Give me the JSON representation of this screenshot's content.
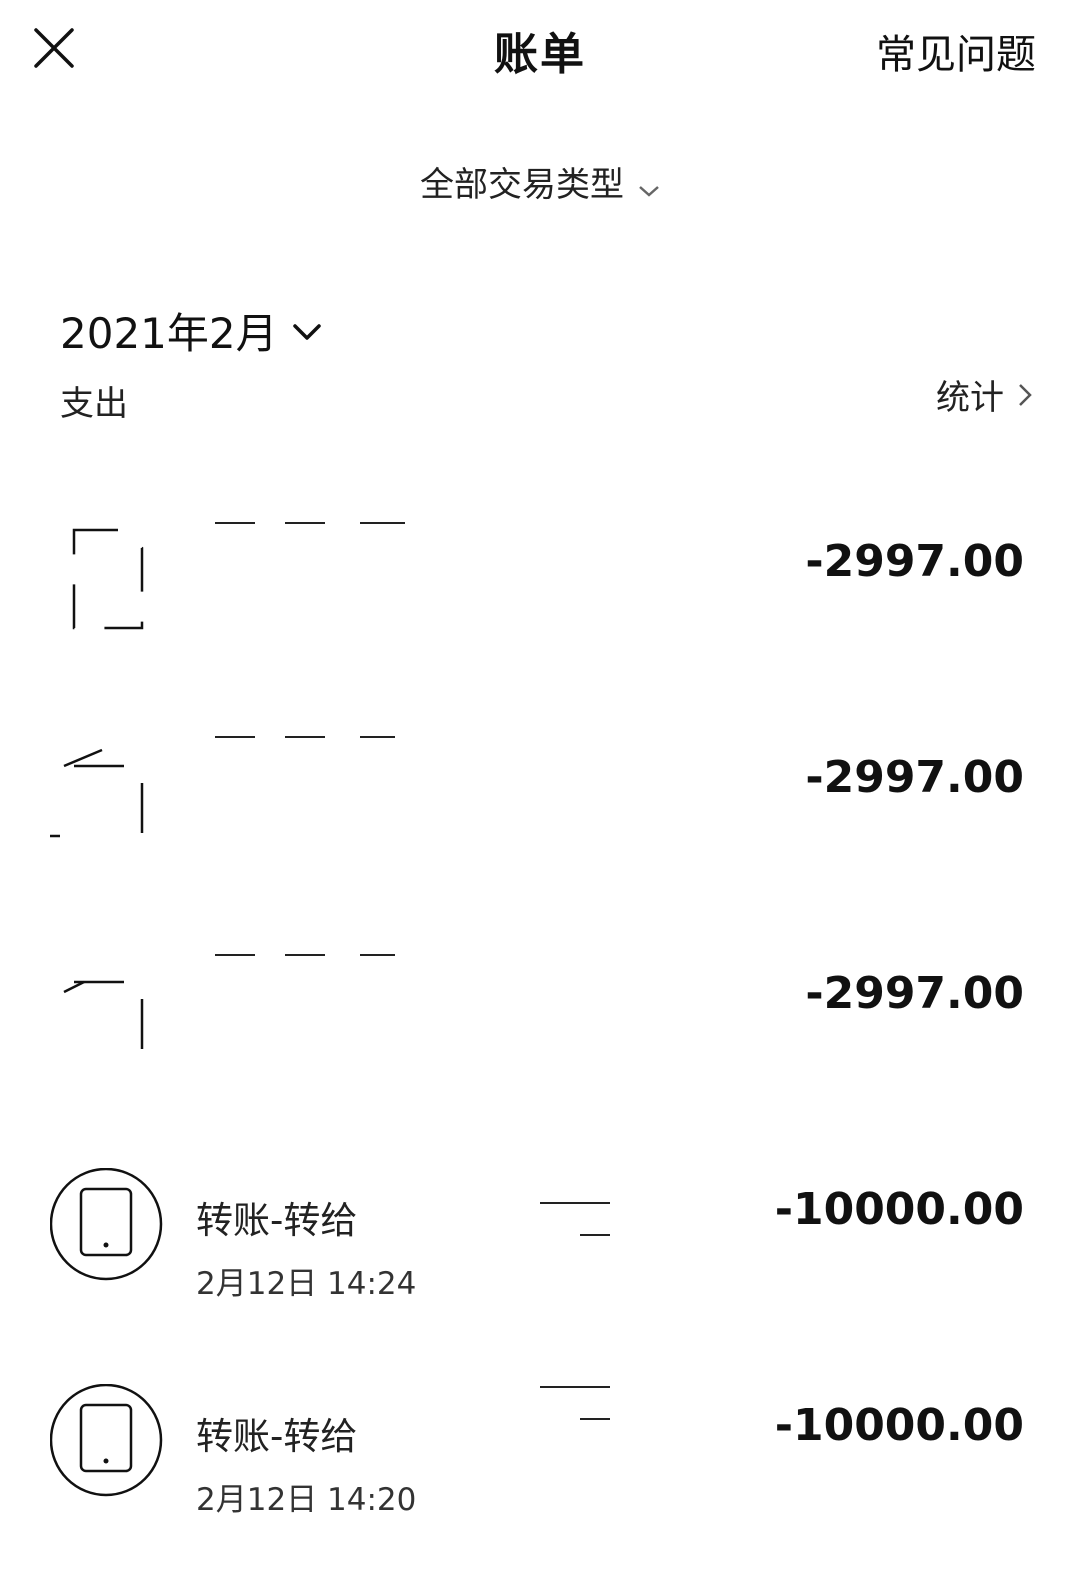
{
  "header": {
    "close_icon": "close-icon",
    "title": "账单",
    "faq_label": "常见问题"
  },
  "filter": {
    "label": "全部交易类型",
    "icon": "chevron-down-icon"
  },
  "summary": {
    "month": "2021年2月",
    "month_icon": "chevron-down-icon",
    "expense_label": "支出",
    "stats_label": "统计",
    "stats_icon": "chevron-right-icon"
  },
  "transactions": [
    {
      "icon": "document-icon",
      "title": "",
      "time": "",
      "amount": "-2997.00"
    },
    {
      "icon": "document-icon",
      "title": "",
      "time": "",
      "amount": "-2997.00"
    },
    {
      "icon": "document-icon",
      "title": "",
      "time": "",
      "amount": "-2997.00"
    },
    {
      "icon": "phone-icon",
      "title": "转账-转给",
      "time": "2月12日 14:24",
      "amount": "-10000.00"
    },
    {
      "icon": "phone-icon",
      "title": "转账-转给",
      "time": "2月12日 14:20",
      "amount": "-10000.00"
    }
  ]
}
